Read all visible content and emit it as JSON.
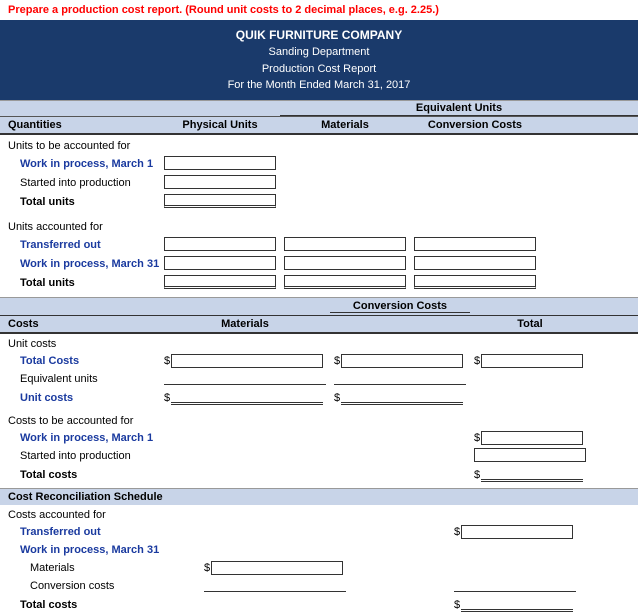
{
  "instruction": {
    "prefix": "Prepare a production cost report. ",
    "highlight": "(Round unit costs to 2 decimal places, e.g. 2.25.)"
  },
  "header": {
    "company": "QUIK FURNITURE COMPANY",
    "department": "Sanding Department",
    "report_title": "Production Cost Report",
    "period": "For the Month Ended March 31, 2017"
  },
  "quantities_section": {
    "title": "Quantities",
    "equiv_units_label": "Equivalent Units",
    "col_physical": "Physical Units",
    "col_materials": "Materials",
    "col_conversion": "Conversion Costs",
    "to_account_for_label": "Units to be accounted for",
    "wip_march1_label": "Work in process, March 1",
    "started_label": "Started into production",
    "total_units_label": "Total units",
    "accounted_for_label": "Units accounted for",
    "transferred_label": "Transferred out",
    "wip_march31_label": "Work in process, March 31",
    "total_units2_label": "Total units"
  },
  "costs_section": {
    "title": "Costs",
    "col_materials": "Materials",
    "col_conversion": "Conversion Costs",
    "col_total": "Total",
    "unit_costs_label": "Unit costs",
    "total_costs_label": "Total Costs",
    "equiv_units_label": "Equivalent units",
    "unit_costs_row_label": "Unit costs",
    "costs_to_account_label": "Costs to be accounted for",
    "wip_march1_label": "Work in process, March 1",
    "started_label": "Started into production",
    "total_costs_label2": "Total costs"
  },
  "reconciliation_section": {
    "title": "Cost Reconciliation Schedule",
    "costs_accounted_label": "Costs accounted for",
    "transferred_label": "Transferred out",
    "wip_march31_label": "Work in process, March 31",
    "materials_label": "Materials",
    "conversion_label": "Conversion costs",
    "total_costs_label": "Total costs"
  }
}
